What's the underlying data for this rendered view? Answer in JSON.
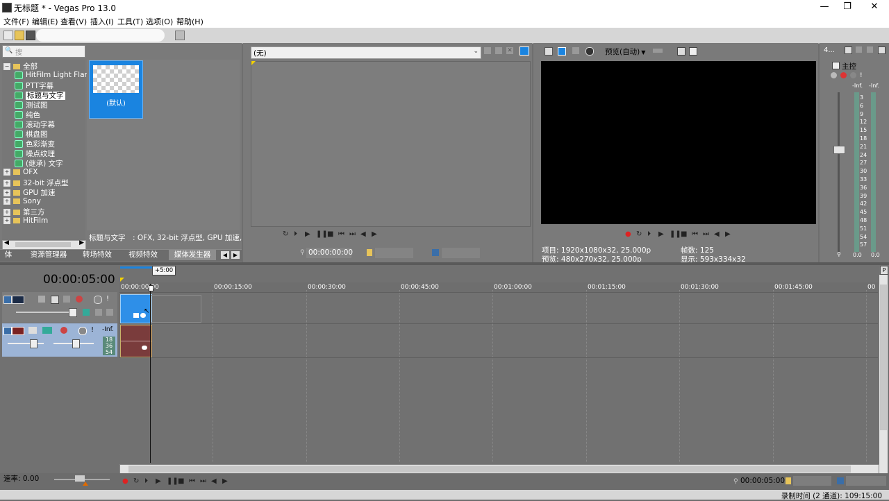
{
  "window": {
    "title": "无标题 * - Vegas Pro 13.0",
    "controls": [
      "—",
      "❐",
      "✕"
    ]
  },
  "menu": [
    "文件(F)",
    "编辑(E)",
    "查看(V)",
    "插入(I)",
    "工具(T)",
    "选项(O)",
    "帮助(H)"
  ],
  "explorer": {
    "search_placeholder": "搜",
    "tree": [
      {
        "label": "全部",
        "type": "root",
        "expanded": true
      },
      {
        "label": "HitFilm Light Flar",
        "type": "leaf"
      },
      {
        "label": "PTT字幕",
        "type": "leaf"
      },
      {
        "label": "标题与文字",
        "type": "leaf",
        "selected": true
      },
      {
        "label": "测试图",
        "type": "leaf"
      },
      {
        "label": "纯色",
        "type": "leaf"
      },
      {
        "label": "滚动字幕",
        "type": "leaf"
      },
      {
        "label": "棋盘图",
        "type": "leaf"
      },
      {
        "label": "色彩渐变",
        "type": "leaf"
      },
      {
        "label": "噪点纹理",
        "type": "leaf"
      },
      {
        "label": "(继承) 文字",
        "type": "leaf"
      },
      {
        "label": "OFX",
        "type": "folder"
      },
      {
        "label": "32-bit 浮点型",
        "type": "folder"
      },
      {
        "label": "GPU 加速",
        "type": "folder"
      },
      {
        "label": "Sony",
        "type": "folder"
      },
      {
        "label": "第三方",
        "type": "folder"
      },
      {
        "label": "HitFilm",
        "type": "folder"
      }
    ],
    "preset_label": "(默认)",
    "status": "标题与文字　: OFX, 32-bit 浮点型, GPU 加速, 分",
    "tabs": [
      "体",
      "资源管理器",
      "转场特效",
      "视频特效",
      "媒体发生器"
    ],
    "active_tab": 4
  },
  "trimmer": {
    "dropdown_value": "(无)",
    "timecode": "00:00:00:00"
  },
  "preview": {
    "quality": "预览(自动)",
    "info": {
      "project_label": "项目:",
      "project_value": "1920x1080x32, 25.000p",
      "preview_label": "预览:",
      "preview_value": "480x270x32, 25.000p",
      "frames_label": "帧数:",
      "frames_value": "125",
      "display_label": "显示:",
      "display_value": "593x334x32"
    }
  },
  "master": {
    "tab_label": "4...",
    "title": "主控",
    "inf_left": "-Inf.",
    "inf_right": "-Inf.",
    "scale": [
      "3",
      "6",
      "9",
      "12",
      "15",
      "18",
      "21",
      "24",
      "27",
      "30",
      "33",
      "36",
      "39",
      "42",
      "45",
      "48",
      "51",
      "54",
      "57"
    ],
    "bottom_left": "0.0",
    "bottom_right": "0.0"
  },
  "timeline": {
    "cursor_time": "00:00:05:00",
    "marker_badge": "+5:00",
    "ruler": [
      "00:00:00:00",
      "00:00:15:00",
      "00:00:30:00",
      "00:00:45:00",
      "00:01:00:00",
      "00:01:15:00",
      "00:01:30:00",
      "00:01:45:00",
      "00"
    ],
    "audio_level_label": "-Inf.",
    "audio_meter": [
      "18",
      "36",
      "54"
    ],
    "rate_label": "速率: 0.00",
    "bottom_timecode": "00:00:05:00",
    "status_bar": "录制时间 (2 通道): 109:15:00"
  },
  "colors": {
    "accent": "#1a84e0",
    "clip_video": "#2e8fe8",
    "clip_audio": "#7a3c3c",
    "track_header": "#9cb4d6",
    "panel_bg": "#7a7a7a"
  }
}
